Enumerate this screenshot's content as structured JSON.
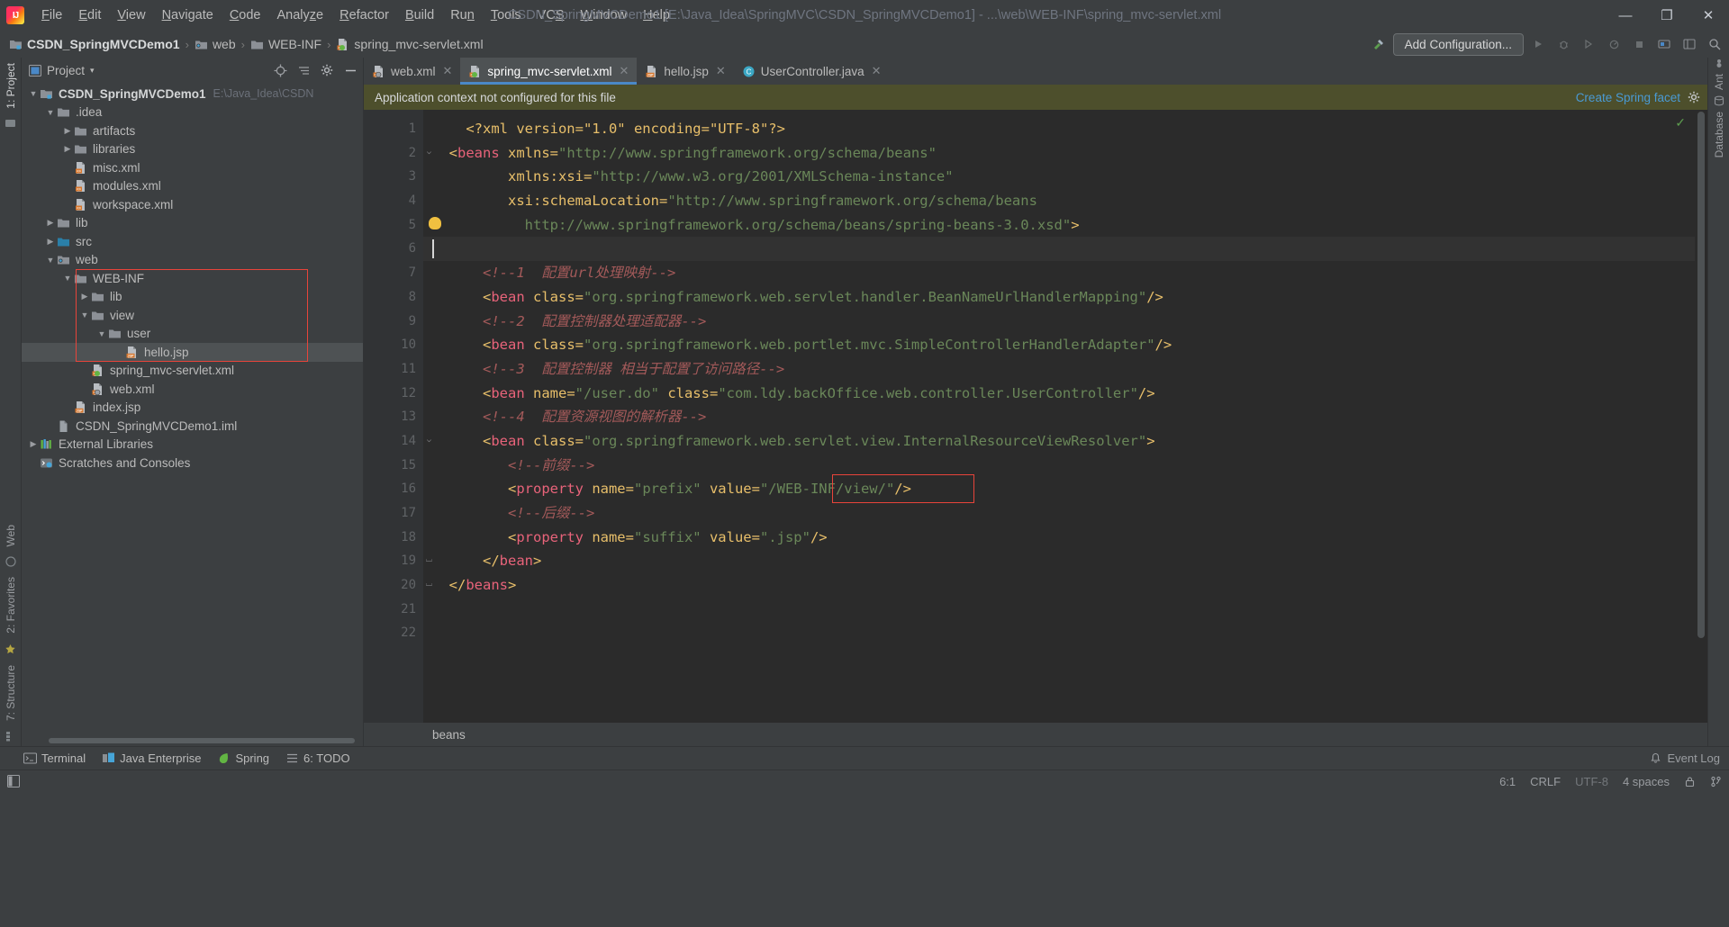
{
  "window": {
    "title": "CSDN_SpringMVCDemo1 [E:\\Java_Idea\\SpringMVC\\CSDN_SpringMVCDemo1] - ...\\web\\WEB-INF\\spring_mvc-servlet.xml",
    "minimize": "—",
    "maximize": "❐",
    "close": "✕"
  },
  "menu": [
    {
      "label": "File"
    },
    {
      "label": "Edit"
    },
    {
      "label": "View"
    },
    {
      "label": "Navigate"
    },
    {
      "label": "Code"
    },
    {
      "label": "Analyze"
    },
    {
      "label": "Refactor"
    },
    {
      "label": "Build"
    },
    {
      "label": "Run"
    },
    {
      "label": "Tools"
    },
    {
      "label": "VCS"
    },
    {
      "label": "Window"
    },
    {
      "label": "Help"
    }
  ],
  "breadcrumb": {
    "items": [
      {
        "label": "CSDN_SpringMVCDemo1",
        "icon": "module-icon"
      },
      {
        "label": "web",
        "icon": "web-folder-icon"
      },
      {
        "label": "WEB-INF",
        "icon": "folder-icon"
      },
      {
        "label": "spring_mvc-servlet.xml",
        "icon": "spring-xml-icon"
      }
    ],
    "separator": "›"
  },
  "navbar_right": {
    "add_configuration": "Add Configuration...",
    "run": "▶",
    "debug": "debug-icon",
    "coverage": "coverage-icon",
    "profile": "profile-icon",
    "stop": "■",
    "search": "search-icon"
  },
  "left_strips": {
    "top": [
      {
        "label": "1: Project",
        "active": true
      }
    ],
    "bottom": [
      {
        "label": "2: Favorites"
      },
      {
        "label": "7: Structure"
      }
    ],
    "web": "Web"
  },
  "right_strips": [
    {
      "label": "Ant"
    },
    {
      "label": "Database"
    }
  ],
  "project_panel": {
    "title": "Project",
    "caret": "▾",
    "actions": [
      "locate-icon",
      "collapse-all-icon",
      "settings-icon",
      "hide-icon"
    ],
    "tree": [
      {
        "depth": 0,
        "arrow": "down",
        "icon": "module-icon",
        "label": "CSDN_SpringMVCDemo1",
        "bold": true,
        "path": "E:\\Java_Idea\\CSDN",
        "selected": false
      },
      {
        "depth": 1,
        "arrow": "down",
        "icon": "folder-icon",
        "label": ".idea",
        "selected": false
      },
      {
        "depth": 2,
        "arrow": "right",
        "icon": "folder-icon",
        "label": "artifacts",
        "selected": false
      },
      {
        "depth": 2,
        "arrow": "right",
        "icon": "folder-icon",
        "label": "libraries",
        "selected": false
      },
      {
        "depth": 2,
        "arrow": "none",
        "icon": "xml-file-icon",
        "label": "misc.xml",
        "selected": false
      },
      {
        "depth": 2,
        "arrow": "none",
        "icon": "xml-file-icon",
        "label": "modules.xml",
        "selected": false
      },
      {
        "depth": 2,
        "arrow": "none",
        "icon": "xml-file-icon",
        "label": "workspace.xml",
        "selected": false
      },
      {
        "depth": 1,
        "arrow": "right",
        "icon": "folder-icon",
        "label": "lib",
        "selected": false
      },
      {
        "depth": 1,
        "arrow": "right",
        "icon": "source-folder-icon",
        "label": "src",
        "selected": false
      },
      {
        "depth": 1,
        "arrow": "down",
        "icon": "web-folder-icon",
        "label": "web",
        "selected": false
      },
      {
        "depth": 2,
        "arrow": "down",
        "icon": "folder-icon",
        "label": "WEB-INF",
        "selected": false
      },
      {
        "depth": 3,
        "arrow": "right",
        "icon": "folder-icon",
        "label": "lib",
        "selected": false
      },
      {
        "depth": 3,
        "arrow": "down",
        "icon": "folder-icon",
        "label": "view",
        "selected": false
      },
      {
        "depth": 4,
        "arrow": "down",
        "icon": "folder-icon",
        "label": "user",
        "selected": false
      },
      {
        "depth": 5,
        "arrow": "none",
        "icon": "jsp-file-icon",
        "label": "hello.jsp",
        "selected": true
      },
      {
        "depth": 3,
        "arrow": "none",
        "icon": "spring-xml-icon",
        "label": "spring_mvc-servlet.xml",
        "selected": false
      },
      {
        "depth": 3,
        "arrow": "none",
        "icon": "web-xml-icon",
        "label": "web.xml",
        "selected": false
      },
      {
        "depth": 2,
        "arrow": "none",
        "icon": "jsp-file-icon",
        "label": "index.jsp",
        "selected": false
      },
      {
        "depth": 1,
        "arrow": "none",
        "icon": "iml-file-icon",
        "label": "CSDN_SpringMVCDemo1.iml",
        "selected": false
      },
      {
        "depth": 0,
        "arrow": "right",
        "icon": "libraries-icon",
        "label": "External Libraries",
        "selected": false
      },
      {
        "depth": 0,
        "arrow": "none",
        "icon": "scratches-icon",
        "label": "Scratches and Consoles",
        "selected": false
      }
    ]
  },
  "editor_tabs": [
    {
      "label": "web.xml",
      "icon": "web-xml-icon",
      "active": false,
      "close": "✕"
    },
    {
      "label": "spring_mvc-servlet.xml",
      "icon": "spring-xml-icon",
      "active": true,
      "close": "✕"
    },
    {
      "label": "hello.jsp",
      "icon": "jsp-file-icon",
      "active": false,
      "close": "✕"
    },
    {
      "label": "UserController.java",
      "icon": "java-class-icon",
      "active": false,
      "close": "✕"
    }
  ],
  "notification": {
    "message": "Application context not configured for this file",
    "link": "Create Spring facet",
    "settings_icon": "gear-icon"
  },
  "editor": {
    "line_count": 22,
    "fold_lines": [
      2,
      14,
      19,
      20
    ],
    "bulb_line": 5,
    "current_line": 6,
    "inspection_ok": "✓",
    "breadcrumb": "beans",
    "lines": [
      {
        "n": 1,
        "tokens": [
          {
            "t": "tg",
            "v": "    "
          },
          {
            "t": "tn",
            "v": "<?xml version=\"1.0\" encoding=\"UTF-8\"?>"
          }
        ]
      },
      {
        "n": 2,
        "tokens": [
          {
            "t": "tg",
            "v": "  <"
          },
          {
            "t": "tk",
            "v": "beans"
          },
          {
            "t": "tn",
            "v": " xmlns="
          },
          {
            "t": "ts",
            "v": "\"http://www.springframework.org/schema/beans\""
          }
        ]
      },
      {
        "n": 3,
        "tokens": [
          {
            "t": "tg",
            "v": "         "
          },
          {
            "t": "tn",
            "v": "xmlns:xsi="
          },
          {
            "t": "ts",
            "v": "\"http://www.w3.org/2001/XMLSchema-instance\""
          }
        ]
      },
      {
        "n": 4,
        "tokens": [
          {
            "t": "tg",
            "v": "         "
          },
          {
            "t": "tn",
            "v": "xsi:schemaLocation="
          },
          {
            "t": "ts",
            "v": "\"http://www.springframework.org/schema/beans"
          }
        ]
      },
      {
        "n": 5,
        "tokens": [
          {
            "t": "ts",
            "v": "           http://www.springframework.org/schema/beans/spring-beans-3.0.xsd\""
          },
          {
            "t": "tg",
            "v": ">"
          }
        ]
      },
      {
        "n": 6,
        "tokens": []
      },
      {
        "n": 7,
        "tokens": [
          {
            "t": "tg",
            "v": "      "
          },
          {
            "t": "tc",
            "v": "<!--1  配置url处理映射-->"
          }
        ]
      },
      {
        "n": 8,
        "tokens": [
          {
            "t": "tg",
            "v": "      <"
          },
          {
            "t": "tk",
            "v": "bean"
          },
          {
            "t": "tn",
            "v": " class="
          },
          {
            "t": "ts",
            "v": "\"org.springframework.web.servlet.handler.BeanNameUrlHandlerMapping\""
          },
          {
            "t": "tg",
            "v": "/>"
          }
        ]
      },
      {
        "n": 9,
        "tokens": [
          {
            "t": "tg",
            "v": "      "
          },
          {
            "t": "tc",
            "v": "<!--2  配置控制器处理适配器-->"
          }
        ]
      },
      {
        "n": 10,
        "tokens": [
          {
            "t": "tg",
            "v": "      <"
          },
          {
            "t": "tk",
            "v": "bean"
          },
          {
            "t": "tn",
            "v": " class="
          },
          {
            "t": "ts",
            "v": "\"org.springframework.web.portlet.mvc.SimpleControllerHandlerAdapter\""
          },
          {
            "t": "tg",
            "v": "/>"
          }
        ]
      },
      {
        "n": 11,
        "tokens": [
          {
            "t": "tg",
            "v": "      "
          },
          {
            "t": "tc",
            "v": "<!--3  配置控制器 相当于配置了访问路径-->"
          }
        ]
      },
      {
        "n": 12,
        "tokens": [
          {
            "t": "tg",
            "v": "      <"
          },
          {
            "t": "tk",
            "v": "bean"
          },
          {
            "t": "tn",
            "v": " name="
          },
          {
            "t": "ts",
            "v": "\"/user.do\""
          },
          {
            "t": "tn",
            "v": " class="
          },
          {
            "t": "ts",
            "v": "\"com.ldy.backOffice.web.controller.UserController\""
          },
          {
            "t": "tg",
            "v": "/>"
          }
        ]
      },
      {
        "n": 13,
        "tokens": [
          {
            "t": "tg",
            "v": "      "
          },
          {
            "t": "tc",
            "v": "<!--4  配置资源视图的解析器-->"
          }
        ]
      },
      {
        "n": 14,
        "tokens": [
          {
            "t": "tg",
            "v": "      <"
          },
          {
            "t": "tk",
            "v": "bean"
          },
          {
            "t": "tn",
            "v": " class="
          },
          {
            "t": "ts",
            "v": "\"org.springframework.web.servlet.view.InternalResourceViewResolver\""
          },
          {
            "t": "tg",
            "v": ">"
          }
        ]
      },
      {
        "n": 15,
        "tokens": [
          {
            "t": "tg",
            "v": "         "
          },
          {
            "t": "tc",
            "v": "<!--前缀-->"
          }
        ]
      },
      {
        "n": 16,
        "tokens": [
          {
            "t": "tg",
            "v": "         <"
          },
          {
            "t": "tk",
            "v": "property"
          },
          {
            "t": "tn",
            "v": " name="
          },
          {
            "t": "ts",
            "v": "\"prefix\""
          },
          {
            "t": "tn",
            "v": " value="
          },
          {
            "t": "ts",
            "v": "\"/WEB-INF/view/\""
          },
          {
            "t": "tg",
            "v": "/>"
          }
        ]
      },
      {
        "n": 17,
        "tokens": [
          {
            "t": "tg",
            "v": "         "
          },
          {
            "t": "tc",
            "v": "<!--后缀-->"
          }
        ]
      },
      {
        "n": 18,
        "tokens": [
          {
            "t": "tg",
            "v": "         <"
          },
          {
            "t": "tk",
            "v": "property"
          },
          {
            "t": "tn",
            "v": " name="
          },
          {
            "t": "ts",
            "v": "\"suffix\""
          },
          {
            "t": "tn",
            "v": " value="
          },
          {
            "t": "ts",
            "v": "\".jsp\""
          },
          {
            "t": "tg",
            "v": "/>"
          }
        ]
      },
      {
        "n": 19,
        "tokens": [
          {
            "t": "tg",
            "v": "      </"
          },
          {
            "t": "tk",
            "v": "bean"
          },
          {
            "t": "tg",
            "v": ">"
          }
        ]
      },
      {
        "n": 20,
        "tokens": [
          {
            "t": "tg",
            "v": "  </"
          },
          {
            "t": "tk",
            "v": "beans"
          },
          {
            "t": "tg",
            "v": ">"
          }
        ]
      },
      {
        "n": 21,
        "tokens": []
      },
      {
        "n": 22,
        "tokens": []
      }
    ]
  },
  "bottom_toolbar": [
    {
      "label": "Terminal",
      "icon": "terminal-icon"
    },
    {
      "label": "Java Enterprise",
      "icon": "java-enterprise-icon"
    },
    {
      "label": "Spring",
      "icon": "spring-leaf-icon"
    },
    {
      "label": "6: TODO",
      "icon": "todo-icon"
    }
  ],
  "bottom_right": {
    "event_log": "Event Log",
    "event_log_icon": "bell-icon"
  },
  "statusbar": {
    "caret": "6:1",
    "line_sep": "CRLF",
    "encoding": "UTF-8",
    "indent": "4 spaces",
    "lock_icon": "lock-icon",
    "branch_icon": "branch-icon",
    "memory_icon": "memory-icon",
    "left_icon": "toggle-toolwindows-icon"
  },
  "colors": {
    "accent_blue": "#4a88c7",
    "annotation_red": "#e8443a",
    "notif_bg": "#4d4f2c",
    "string_green": "#6a8759",
    "tag_pink": "#e8637a",
    "attr_yellow": "#e8bf6a",
    "comment_red": "#a45a5a"
  }
}
